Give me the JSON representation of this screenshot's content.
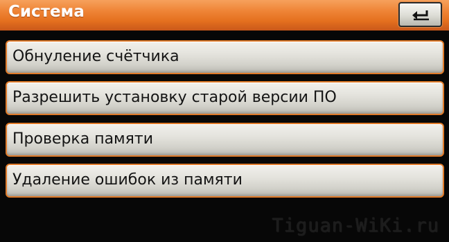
{
  "header": {
    "title": "Система",
    "back_icon": "return-arrow-icon",
    "accent_color": "#e8772a"
  },
  "menu": {
    "items": [
      {
        "label": "Обнуление счётчика"
      },
      {
        "label": "Разрешить установку старой версии ПО"
      },
      {
        "label": "Проверка памяти"
      },
      {
        "label": "Удаление ошибок из памяти"
      }
    ]
  },
  "watermark": "Tiguan-WiKi.ru"
}
